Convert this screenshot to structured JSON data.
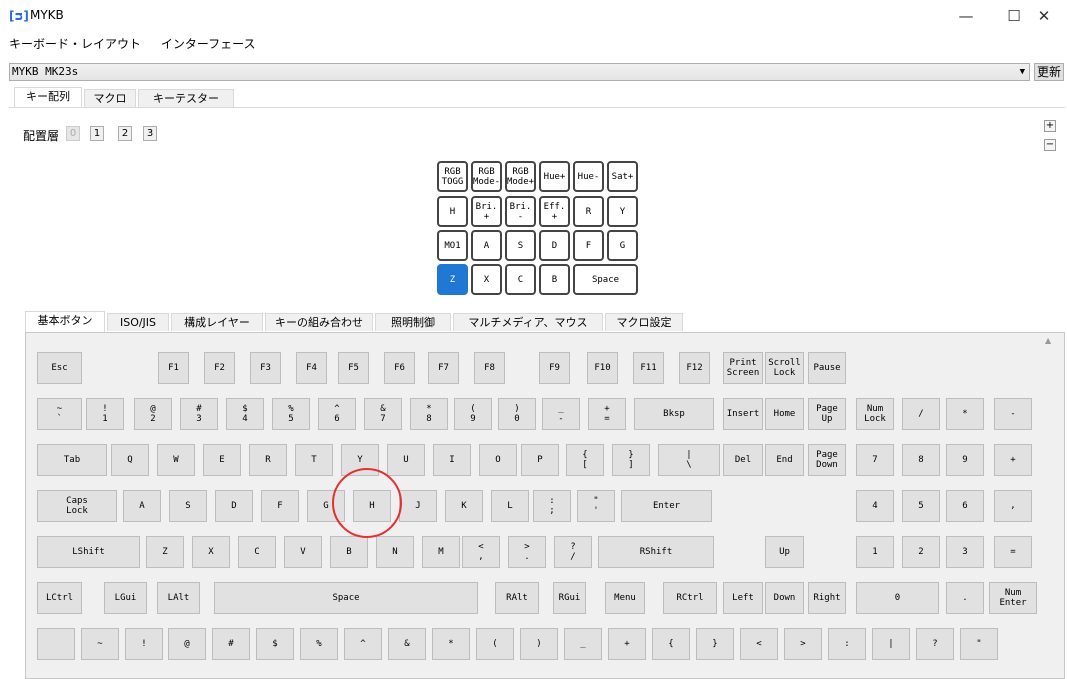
{
  "app": {
    "logo": "[ᴝ]",
    "title": "MYKB"
  },
  "window": {
    "minimize": "—",
    "maximize": "☐",
    "close": "✕"
  },
  "menu": [
    "キーボード・レイアウト",
    "インターフェース"
  ],
  "device": {
    "selected": "MYKB MK23s",
    "arrow": "▼",
    "refresh": "更新"
  },
  "tabs": [
    "キー配列",
    "マクロ",
    "キーテスター"
  ],
  "layer": {
    "label": "配置層",
    "options": [
      "0",
      "1",
      "2",
      "3"
    ],
    "selected": "0"
  },
  "zoom": {
    "plus": "+",
    "minus": "−"
  },
  "preview_keys": [
    [
      "RGB\nTOGG",
      "RGB\nMode-",
      "RGB\nMode+",
      "Hue+",
      "Hue-",
      "Sat+"
    ],
    [
      "H",
      "Bri. +",
      "Bri. -",
      "Eff. +",
      "R",
      "Y"
    ],
    [
      "MO1",
      "A",
      "S",
      "D",
      "F",
      "G"
    ],
    [
      "Z",
      "X",
      "C",
      "B",
      "Space"
    ]
  ],
  "selected_preview_key": "Z",
  "bottom_tabs": [
    "基本ボタン",
    "ISO/JIS",
    "構成レイヤー",
    "キーの組み合わせ",
    "照明制御",
    "マルチメディア、マウス",
    "マクロ設定"
  ],
  "keyboard_rows": [
    [
      "Esc",
      "F1",
      "F2",
      "F3",
      "F4",
      "F5",
      "F6",
      "F7",
      "F8",
      "F9",
      "F10",
      "F11",
      "F12",
      "Print\nScreen",
      "Scroll\nLock",
      "Pause"
    ],
    [
      "~\n`",
      "!\n1",
      "@\n2",
      "#\n3",
      "$\n4",
      "%\n5",
      "^\n6",
      "&\n7",
      "*\n8",
      "(\n9",
      ")\n0",
      "_\n-",
      "+\n=",
      "Bksp",
      "Insert",
      "Home",
      "Page\nUp",
      "Num\nLock",
      "/",
      "*",
      "-"
    ],
    [
      "Tab",
      "Q",
      "W",
      "E",
      "R",
      "T",
      "Y",
      "U",
      "I",
      "O",
      "P",
      "{\n[",
      "}\n]",
      "|\n\\",
      "Del",
      "End",
      "Page\nDown",
      "7",
      "8",
      "9",
      "+"
    ],
    [
      "Caps\nLock",
      "A",
      "S",
      "D",
      "F",
      "G",
      "H",
      "J",
      "K",
      "L",
      ":\n;",
      "\"\n'",
      "Enter",
      "4",
      "5",
      "6",
      ","
    ],
    [
      "LShift",
      "Z",
      "X",
      "C",
      "V",
      "B",
      "N",
      "M",
      "<\n,",
      ">\n.",
      "?\n/",
      "RShift",
      "Up",
      "1",
      "2",
      "3",
      "="
    ],
    [
      "LCtrl",
      "LGui",
      "LAlt",
      "Space",
      "RAlt",
      "RGui",
      "Menu",
      "RCtrl",
      "Left",
      "Down",
      "Right",
      "0",
      ".",
      "Num\nEnter"
    ],
    [
      "",
      "~",
      "!",
      "@",
      "#",
      "$",
      "%",
      "^",
      "&",
      "*",
      "(",
      ")",
      "_",
      "+",
      "{",
      "}",
      "<",
      ">",
      ":",
      "|",
      "?",
      "\""
    ]
  ],
  "highlighted_key": "H"
}
